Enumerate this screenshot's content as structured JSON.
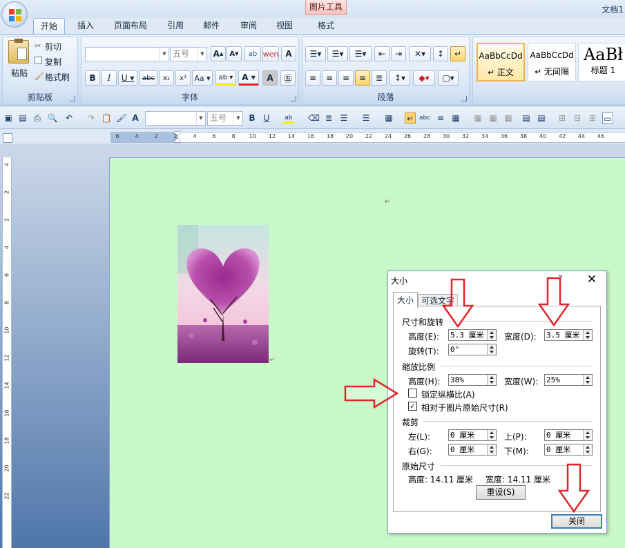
{
  "window": {
    "doc_title": "文档1"
  },
  "contextual_header": "图片工具",
  "tabs": [
    "开始",
    "插入",
    "页面布局",
    "引用",
    "邮件",
    "审阅",
    "视图",
    "格式"
  ],
  "ribbon": {
    "clipboard": {
      "label": "剪贴板",
      "paste": "粘贴",
      "cut": "剪切",
      "copy": "复制",
      "format_painter": "格式刷"
    },
    "font": {
      "label": "字体",
      "font_name": "",
      "font_size": "五号"
    },
    "paragraph": {
      "label": "段落"
    },
    "styles": [
      {
        "sample": "AaBbCcDd",
        "name": "↵ 正文"
      },
      {
        "sample": "AaBbCcDd",
        "name": "↵ 无间隔"
      },
      {
        "sample": "AaBł",
        "name": "标题 1"
      }
    ]
  },
  "toolbar": {
    "font_size": "五号"
  },
  "ruler": {
    "h_labels": [
      "6",
      "4",
      "2",
      "2",
      "4",
      "6",
      "8",
      "10",
      "12",
      "14",
      "16",
      "18",
      "20",
      "22",
      "24",
      "26",
      "28",
      "30",
      "32",
      "34",
      "36",
      "38",
      "40",
      "42",
      "44",
      "46"
    ],
    "v_labels": [
      "4",
      "2",
      "2",
      "4",
      "6",
      "8",
      "10",
      "12",
      "14",
      "16",
      "18",
      "20",
      "22"
    ]
  },
  "document": {
    "para_mark": "↵"
  },
  "dialog": {
    "title": "大小",
    "help": "?",
    "tabs": [
      "大小",
      "可选文字"
    ],
    "size_rotate": {
      "header": "尺寸和旋转",
      "height_label": "高度(E):",
      "height_value": "5.3 厘米",
      "width_label": "宽度(D):",
      "width_value": "3.5 厘米",
      "rotate_label": "旋转(T):",
      "rotate_value": "0°"
    },
    "scale": {
      "header": "缩放比例",
      "height_label": "高度(H):",
      "height_value": "38%",
      "width_label": "宽度(W):",
      "width_value": "25%",
      "lock_aspect": "锁定纵横比(A)",
      "lock_checked": false,
      "relative": "相对于图片原始尺寸(R)",
      "relative_checked": true
    },
    "crop": {
      "header": "裁剪",
      "left_label": "左(L):",
      "left_value": "0 厘米",
      "top_label": "上(P):",
      "top_value": "0 厘米",
      "right_label": "右(G):",
      "right_value": "0 厘米",
      "bottom_label": "下(M):",
      "bottom_value": "0 厘米"
    },
    "original": {
      "header": "原始尺寸",
      "height_text": "高度:  14.11 厘米",
      "width_text": "宽度:  14.11 厘米"
    },
    "reset_button": "重设(S)",
    "close_button": "关闭"
  },
  "colors": {
    "page_bg": "#c9f9c8",
    "annotation_arrow": "#e0262a",
    "ribbon_bg": "#d2e1f3"
  }
}
